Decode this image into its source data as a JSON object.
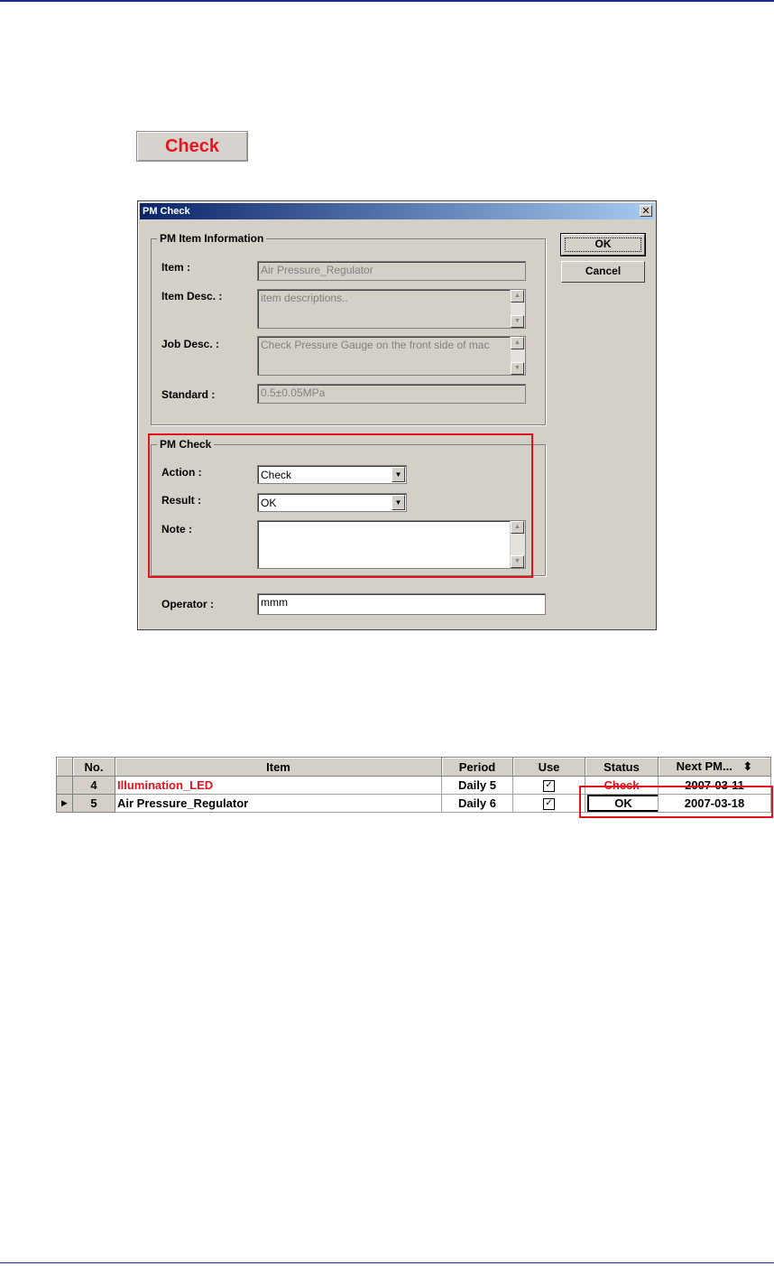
{
  "top_button": {
    "label": "Check"
  },
  "dialog": {
    "title": "PM Check",
    "close_glyph": "✕",
    "ok_label": "OK",
    "cancel_label": "Cancel",
    "info_group": {
      "legend": "PM Item Information",
      "item_label": "Item :",
      "item_value": "Air Pressure_Regulator",
      "item_desc_label": "Item Desc. :",
      "item_desc_value": "item descriptions..",
      "job_desc_label": "Job Desc. :",
      "job_desc_value": "Check Pressure Gauge on the front side of mac",
      "standard_label": "Standard :",
      "standard_value": "0.5±0.05MPa"
    },
    "check_group": {
      "legend": "PM Check",
      "action_label": "Action :",
      "action_value": "Check",
      "result_label": "Result :",
      "result_value": "OK",
      "note_label": "Note :",
      "note_value": ""
    },
    "operator_label": "Operator :",
    "operator_value": "mmm"
  },
  "grid": {
    "columns": [
      "No.",
      "Item",
      "Period",
      "Use",
      "Status",
      "Next PM..."
    ],
    "sort_glyph": "⬍",
    "rows": [
      {
        "no": "4",
        "item": "Illumination_LED",
        "period": "Daily 5",
        "use": "✓",
        "status": "Check",
        "next_pm": "2007-03-11"
      },
      {
        "no": "5",
        "item": "Air Pressure_Regulator",
        "period": "Daily 6",
        "use": "✓",
        "status": "OK",
        "next_pm": "2007-03-18"
      }
    ],
    "row_indicator": "▶"
  },
  "colors": {
    "accent_red": "#e0141e",
    "title_blue": "#0a246a",
    "face": "#d4d0c8"
  }
}
